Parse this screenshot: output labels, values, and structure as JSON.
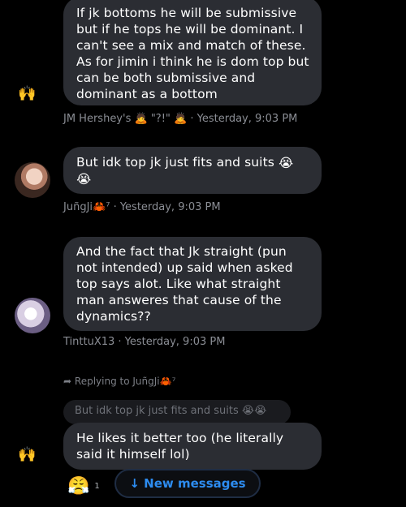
{
  "messages": [
    {
      "lines": [
        "If jk bottoms he will be submissive",
        "but if he tops he will be dominant. I",
        "can't see a mix and match of these.",
        "As for jimin i think he is dom top but",
        "can be both submissive and",
        "dominant as a bottom"
      ],
      "author": "JM Hershey's",
      "author_suffix": "\"?!\"",
      "time": "· Yesterday, 9:03 PM"
    },
    {
      "lines": [
        "But idk top jk just fits and suits"
      ],
      "author": "JuñgJi",
      "author_suffix": "⁷",
      "time": "· Yesterday, 9:03 PM"
    },
    {
      "lines": [
        "And the fact that Jk straight (pun",
        "not intended) up said when asked",
        "top says alot. Like what straight",
        "man answeres that cause of the",
        "dynamics??"
      ],
      "author": "TinttuX13",
      "time": "· Yesterday, 9:03 PM"
    }
  ],
  "reply": {
    "replying_to_label": "Replying to JuñgJi",
    "replying_to_suffix": "⁷",
    "quoted_text": "But idk top jk just fits and suits",
    "lines": [
      "He likes it better too (he literally",
      "said it himself lol)"
    ]
  },
  "reaction": {
    "count": "1"
  },
  "new_messages_label": "↓ New messages",
  "colors": {
    "bubble": "#2b2d33",
    "meta": "#8b8e95",
    "accent": "#2d8cf0"
  },
  "icons": [
    "wave-emoji-icon",
    "loudly-crying-face-icon",
    "crab-icon",
    "reply-arrow-icon",
    "pouting-face-icon",
    "weary-face-icon"
  ]
}
